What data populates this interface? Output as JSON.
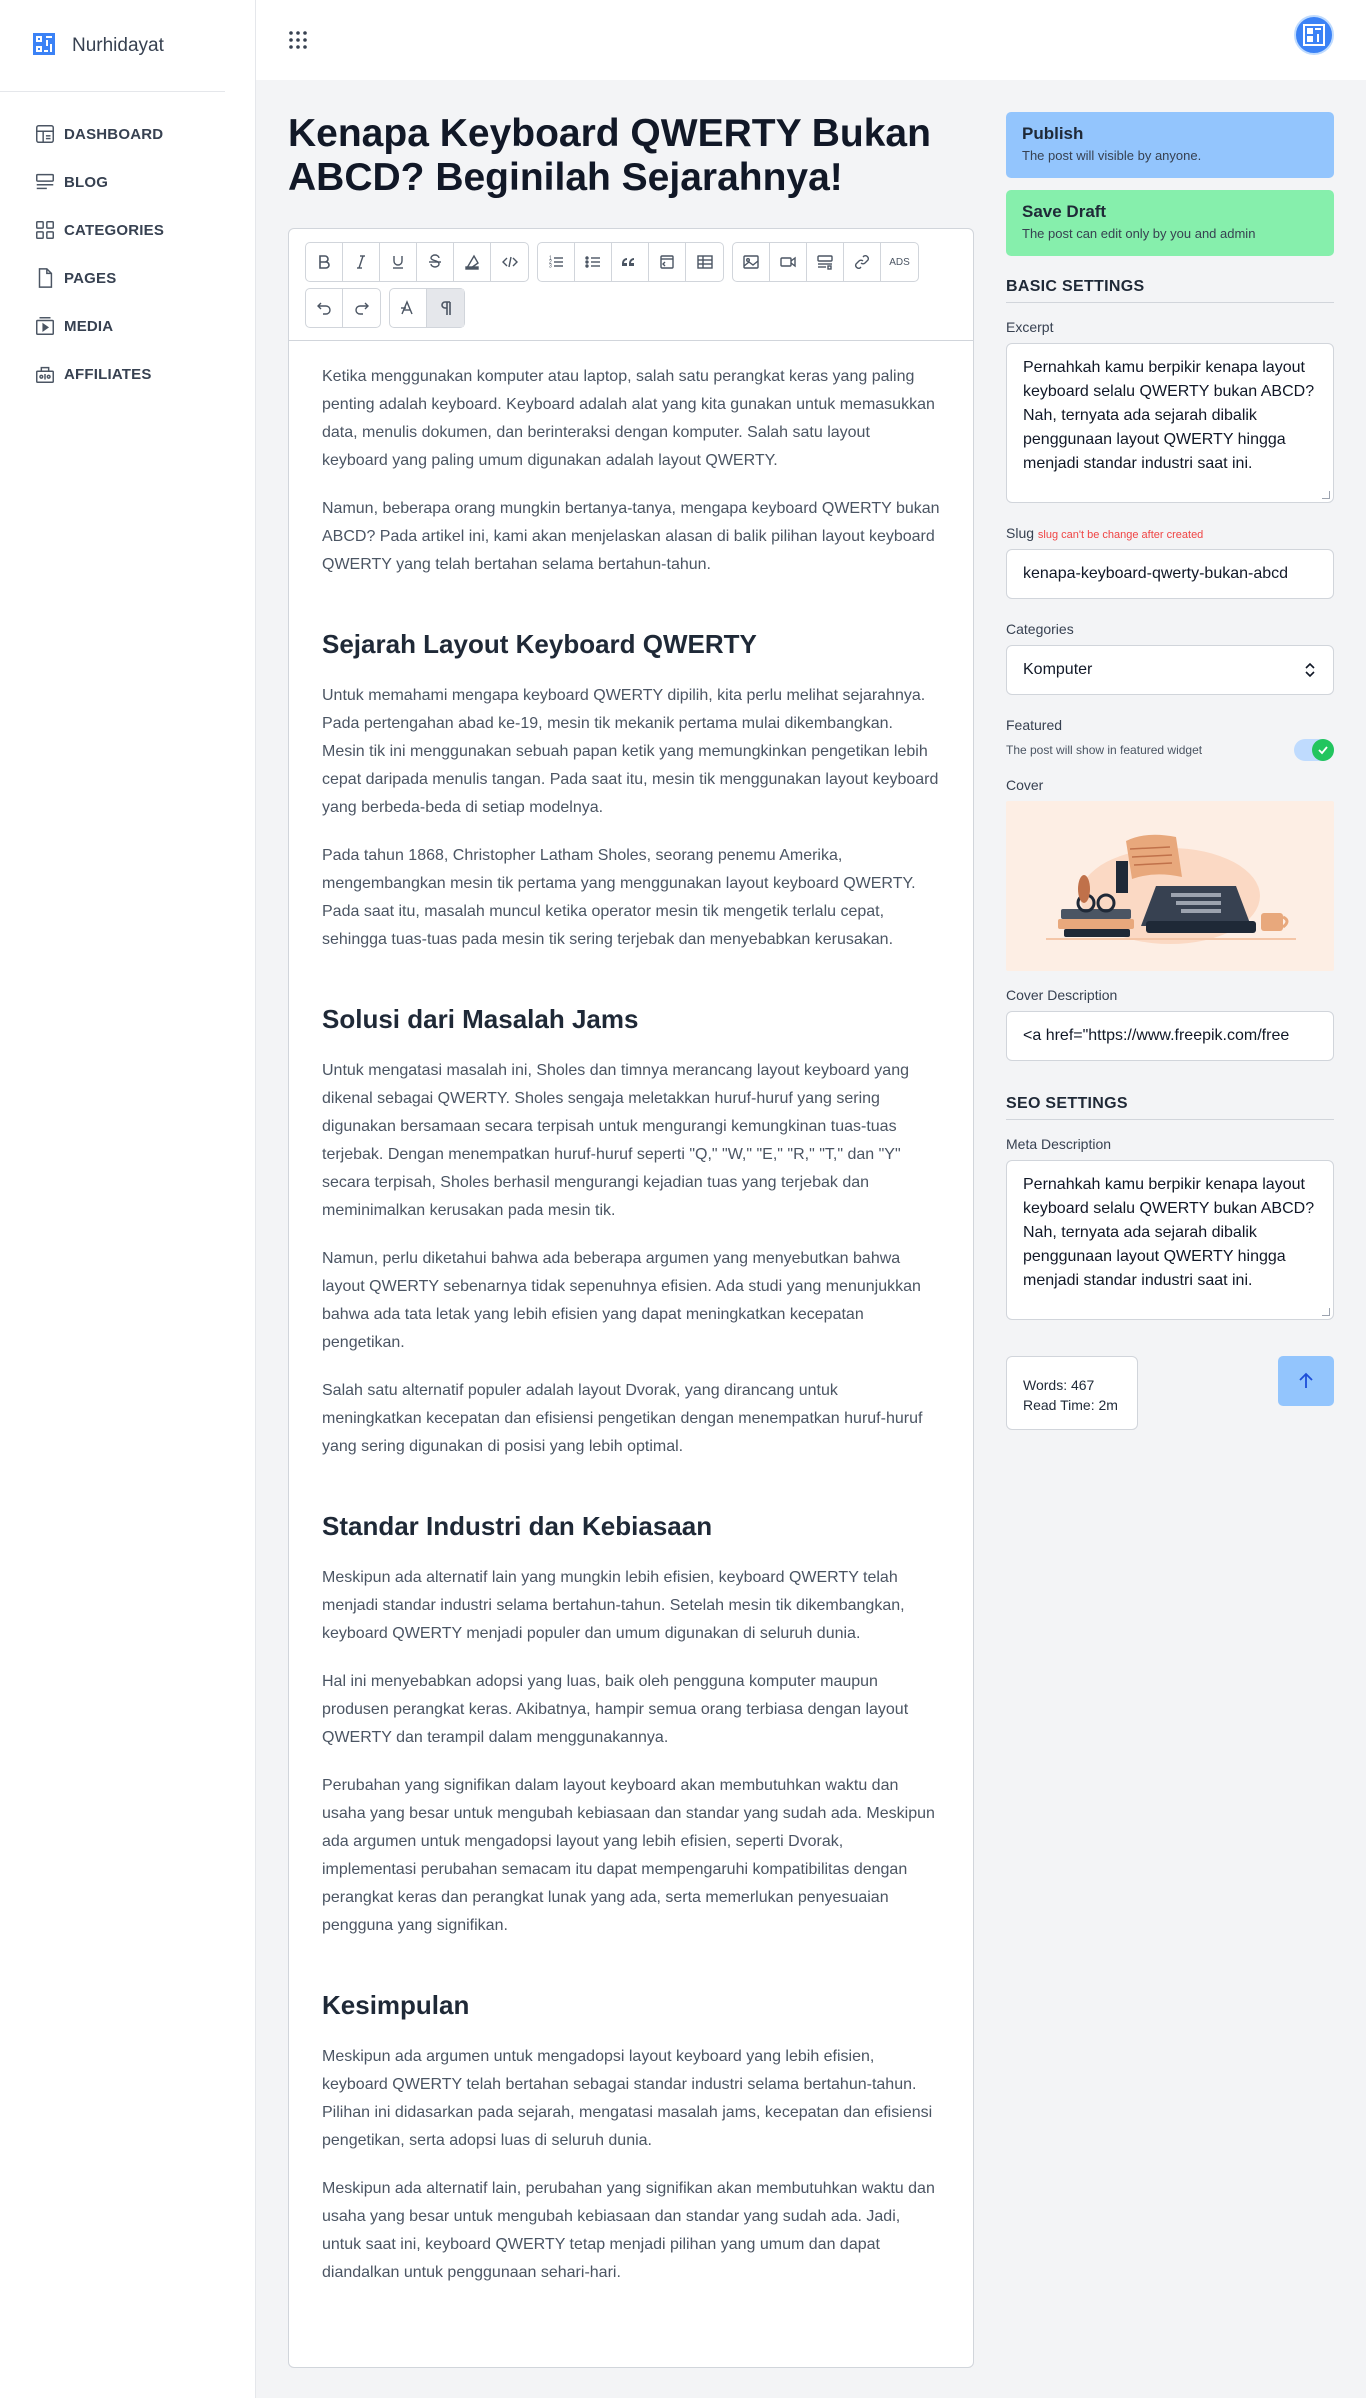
{
  "brand": {
    "name": "Nurhidayat"
  },
  "sidebar": {
    "items": [
      {
        "label": "DASHBOARD",
        "icon": "dashboard-icon"
      },
      {
        "label": "BLOG",
        "icon": "blog-icon"
      },
      {
        "label": "CATEGORIES",
        "icon": "categories-icon"
      },
      {
        "label": "PAGES",
        "icon": "page-icon"
      },
      {
        "label": "MEDIA",
        "icon": "media-icon"
      },
      {
        "label": "AFFILIATES",
        "icon": "affiliates-icon"
      }
    ]
  },
  "post": {
    "title": "Kenapa Keyboard QWERTY Bukan ABCD? Beginilah Sejarahnya!",
    "toolbar": {
      "ads_label": "ADS"
    },
    "body": {
      "p1": "Ketika menggunakan komputer atau laptop, salah satu perangkat keras yang paling penting adalah keyboard. Keyboard adalah alat yang kita gunakan untuk memasukkan data, menulis dokumen, dan berinteraksi dengan komputer. Salah satu layout keyboard yang paling umum digunakan adalah layout QWERTY.",
      "p2": "Namun, beberapa orang mungkin bertanya-tanya, mengapa keyboard QWERTY bukan ABCD? Pada artikel ini, kami akan menjelaskan alasan di balik pilihan layout keyboard QWERTY yang telah bertahan selama bertahun-tahun.",
      "h1": "Sejarah Layout Keyboard QWERTY",
      "p3": "Untuk memahami mengapa keyboard QWERTY dipilih, kita perlu melihat sejarahnya. Pada pertengahan abad ke-19, mesin tik mekanik pertama mulai dikembangkan. Mesin tik ini menggunakan sebuah papan ketik yang memungkinkan pengetikan lebih cepat daripada menulis tangan. Pada saat itu, mesin tik menggunakan layout keyboard yang berbeda-beda di setiap modelnya.",
      "p4": "Pada tahun 1868, Christopher Latham Sholes, seorang penemu Amerika, mengembangkan mesin tik pertama yang menggunakan layout keyboard QWERTY. Pada saat itu, masalah muncul ketika operator mesin tik mengetik terlalu cepat, sehingga tuas-tuas pada mesin tik sering terjebak dan menyebabkan kerusakan.",
      "h2": "Solusi dari Masalah Jams",
      "p5": "Untuk mengatasi masalah ini, Sholes dan timnya merancang layout keyboard yang dikenal sebagai QWERTY. Sholes sengaja meletakkan huruf-huruf yang sering digunakan bersamaan secara terpisah untuk mengurangi kemungkinan tuas-tuas terjebak. Dengan menempatkan huruf-huruf seperti \"Q,\" \"W,\" \"E,\" \"R,\" \"T,\" dan \"Y\" secara terpisah, Sholes berhasil mengurangi kejadian tuas yang terjebak dan meminimalkan kerusakan pada mesin tik.",
      "p6": "Namun, perlu diketahui bahwa ada beberapa argumen yang menyebutkan bahwa layout QWERTY sebenarnya tidak sepenuhnya efisien. Ada studi yang menunjukkan bahwa ada tata letak yang lebih efisien yang dapat meningkatkan kecepatan pengetikan.",
      "p7": "Salah satu alternatif populer adalah layout Dvorak, yang dirancang untuk meningkatkan kecepatan dan efisiensi pengetikan dengan menempatkan huruf-huruf yang sering digunakan di posisi yang lebih optimal.",
      "h3": "Standar Industri dan Kebiasaan",
      "p8": "Meskipun ada alternatif lain yang mungkin lebih efisien, keyboard QWERTY telah menjadi standar industri selama bertahun-tahun. Setelah mesin tik dikembangkan, keyboard QWERTY menjadi populer dan umum digunakan di seluruh dunia.",
      "p9": "Hal ini menyebabkan adopsi yang luas, baik oleh pengguna komputer maupun produsen perangkat keras. Akibatnya, hampir semua orang terbiasa dengan layout QWERTY dan terampil dalam menggunakannya.",
      "p10": "Perubahan yang signifikan dalam layout keyboard akan membutuhkan waktu dan usaha yang besar untuk mengubah kebiasaan dan standar yang sudah ada. Meskipun ada argumen untuk mengadopsi layout yang lebih efisien, seperti Dvorak, implementasi perubahan semacam itu dapat mempengaruhi kompatibilitas dengan perangkat keras dan perangkat lunak yang ada, serta memerlukan penyesuaian pengguna yang signifikan.",
      "h4": "Kesimpulan",
      "p11": "Meskipun ada argumen untuk mengadopsi layout keyboard yang lebih efisien, keyboard QWERTY telah bertahan sebagai standar industri selama bertahun-tahun. Pilihan ini didasarkan pada sejarah, mengatasi masalah jams, kecepatan dan efisiensi pengetikan, serta adopsi luas di seluruh dunia.",
      "p12": "Meskipun ada alternatif lain, perubahan yang signifikan akan membutuhkan waktu dan usaha yang besar untuk mengubah kebiasaan dan standar yang sudah ada. Jadi, untuk saat ini, keyboard QWERTY tetap menjadi pilihan yang umum dan dapat diandalkan untuk penggunaan sehari-hari."
    }
  },
  "actions": {
    "publish_title": "Publish",
    "publish_sub": "The post will visible by anyone.",
    "draft_title": "Save Draft",
    "draft_sub": "The post can edit only by you and admin"
  },
  "basic": {
    "heading": "BASIC SETTINGS",
    "excerpt_label": "Excerpt",
    "excerpt_value": "Pernahkah kamu berpikir kenapa layout keyboard selalu QWERTY bukan ABCD? Nah, ternyata ada sejarah dibalik penggunaan layout QWERTY hingga menjadi standar industri saat ini.",
    "slug_label": "Slug",
    "slug_hint": "slug can't be change after created",
    "slug_value": "kenapa-keyboard-qwerty-bukan-abcd",
    "categories_label": "Categories",
    "categories_value": "Komputer",
    "featured_label": "Featured",
    "featured_hint": "The post will show in featured widget",
    "featured_on": true,
    "cover_label": "Cover",
    "cover_desc_label": "Cover Description",
    "cover_desc_value": "<a href=\"https://www.freepik.com/free"
  },
  "seo": {
    "heading": "SEO SETTINGS",
    "meta_label": "Meta Description",
    "meta_value": "Pernahkah kamu berpikir kenapa layout keyboard selalu QWERTY bukan ABCD? Nah, ternyata ada sejarah dibalik penggunaan layout QWERTY hingga menjadi standar industri saat ini."
  },
  "stats": {
    "words": "Words: 467",
    "read_time": "Read Time: 2m"
  },
  "colors": {
    "accent": "#3b82f6",
    "publish": "#93c5fd",
    "draft": "#86efac",
    "toggle_on": "#22c55e",
    "hint": "#ef4444"
  }
}
